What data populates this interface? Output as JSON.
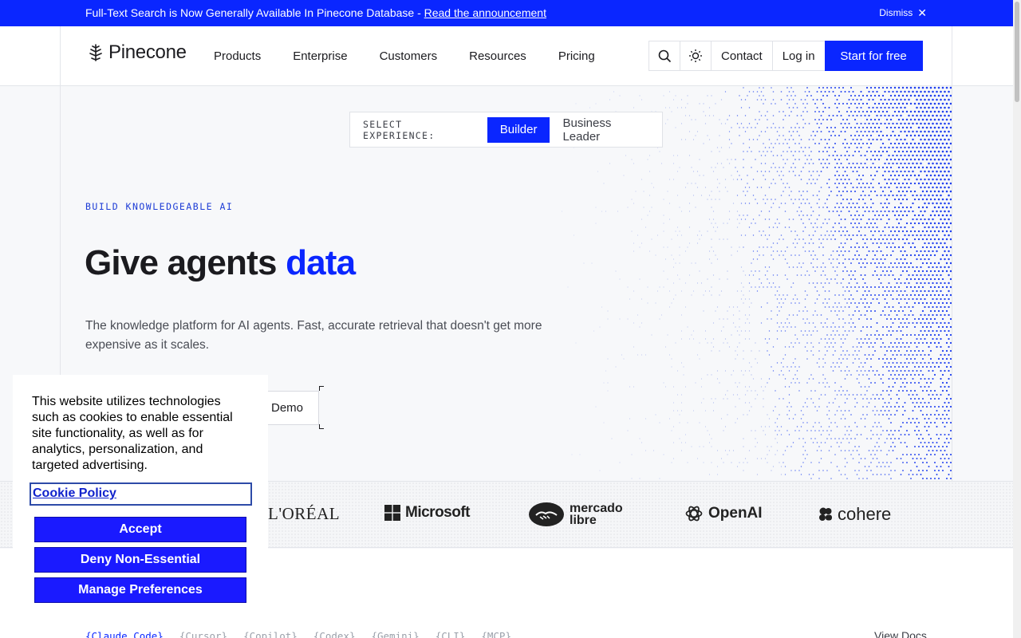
{
  "announcement": {
    "text": "Full-Text Search is Now Generally Available In Pinecone Database - ",
    "link": "Read the announcement",
    "dismiss": "Dismiss"
  },
  "header": {
    "brand": "Pinecone",
    "nav": [
      "Products",
      "Enterprise",
      "Customers",
      "Resources",
      "Pricing"
    ],
    "contact": "Contact",
    "login": "Log in",
    "cta": "Start for free"
  },
  "experience": {
    "label": "SELECT EXPERIENCE:",
    "options": [
      "Builder",
      "Business Leader"
    ],
    "selected": "Builder"
  },
  "hero": {
    "eyebrow": "BUILD KNOWLEDGEABLE AI",
    "headline_plain": "Give agents ",
    "headline_accent": "data",
    "subcopy": "The knowledge platform for AI agents. Fast, accurate retrieval that doesn't get more expensive as it scales.",
    "demo_button": "Demo"
  },
  "logos": [
    "L'ORÉAL",
    "Microsoft",
    "mercado libre",
    "OpenAI",
    "cohere"
  ],
  "code_tabs": [
    "{Claude Code}",
    "{Cursor}",
    "{Copilot}",
    "{Codex}",
    "{Gemini}",
    "{CLI}",
    "{MCP}"
  ],
  "view_docs": "View Docs",
  "cookie": {
    "text": "This website utilizes technologies such as cookies to enable essential site functionality, as well as for analytics, personalization, and targeted advertising.",
    "policy_link": "Cookie Policy",
    "accept": "Accept",
    "deny": "Deny Non-Essential",
    "manage": "Manage Preferences"
  },
  "colors": {
    "brand_blue": "#0a26ff",
    "cookie_button": "#1a1aff"
  }
}
